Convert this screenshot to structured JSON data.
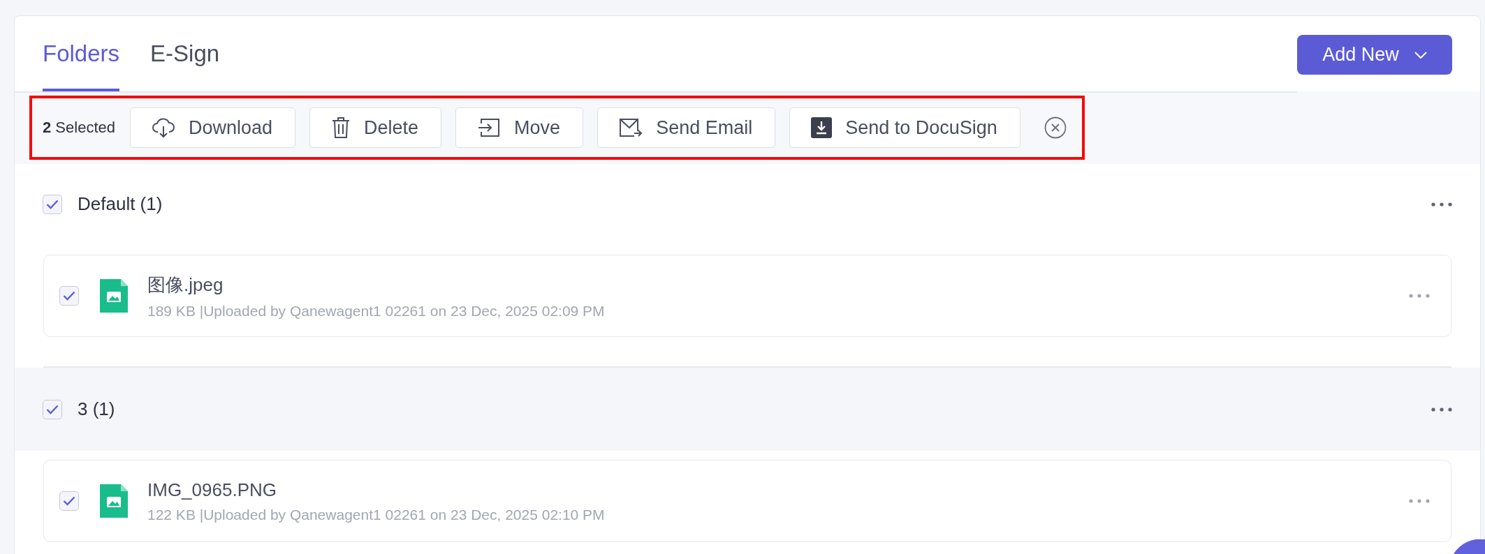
{
  "tabs": [
    {
      "label": "Folders",
      "selected": true
    },
    {
      "label": "E-Sign",
      "selected": false
    }
  ],
  "add_button": {
    "label": "Add New"
  },
  "selection_bar": {
    "highlighted": true,
    "count_label": "**2** Selected",
    "actions": [
      {
        "kind": "download",
        "label": "Download"
      },
      {
        "kind": "delete",
        "label": "Delete"
      },
      {
        "kind": "move",
        "label": "Move"
      },
      {
        "kind": "email",
        "label": "Send Email"
      },
      {
        "kind": "docusign",
        "label": "Send to DocuSign"
      }
    ]
  },
  "groups": [
    {
      "name": "Default (1)",
      "checked": true,
      "hovered": false,
      "files": [
        {
          "name": "图像.jpeg",
          "meta": "189 KB |Uploaded by Qanewagent1 02261 on 23 Dec, 2025 02:09 PM",
          "checked": true
        }
      ]
    },
    {
      "name": "3 (1)",
      "checked": true,
      "hovered": true,
      "files": [
        {
          "name": "IMG_0965.PNG",
          "meta": "122 KB |Uploaded by Qanewagent1 02261 on 23 Dec, 2025 02:10 PM",
          "checked": true
        }
      ]
    }
  ]
}
